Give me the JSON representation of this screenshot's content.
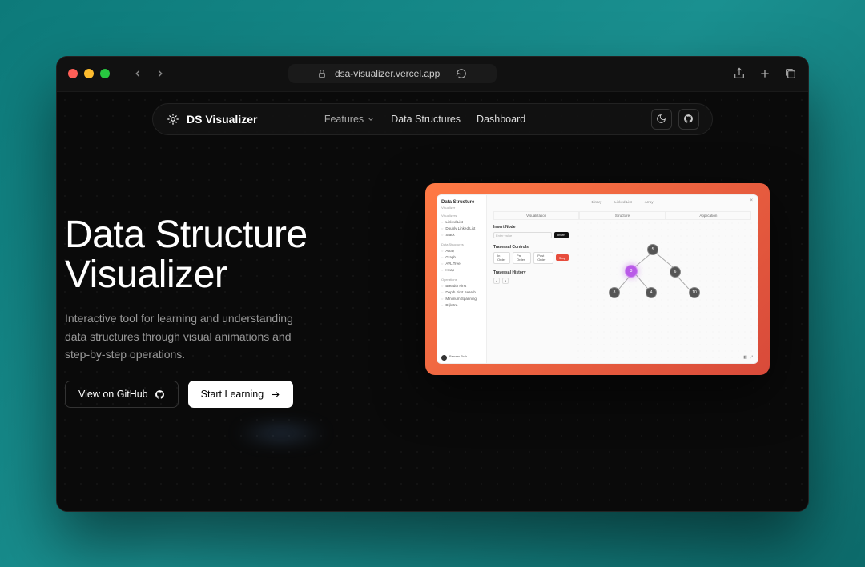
{
  "browser": {
    "url": "dsa-visualizer.vercel.app"
  },
  "navbar": {
    "brand": "DS Visualizer",
    "items": {
      "features": "Features",
      "data_structures": "Data Structures",
      "dashboard": "Dashboard"
    }
  },
  "hero": {
    "title_line1": "Data Structure",
    "title_line2": "Visualizer",
    "subtitle": "Interactive tool for learning and understanding data structures through visual animations and step-by-step operations.",
    "cta_github": "View on GitHub",
    "cta_start": "Start Learning"
  },
  "preview": {
    "app_title": "Data Structure",
    "app_subtitle": "Visualizer",
    "sidebar_groups": [
      {
        "label": "Visualizers",
        "items": [
          "Linked List",
          "Doubly Linked List",
          "Stack"
        ]
      },
      {
        "label": "Data Structures",
        "items": [
          "Array",
          "Graph",
          "AVL Tree",
          "Heap"
        ]
      },
      {
        "label": "Operations",
        "items": [
          "Breadth First",
          "Depth First Search",
          "Minimum Spanning",
          "Dijkstra"
        ]
      }
    ],
    "top_tabs": [
      "Binary",
      "Linked List",
      "Array"
    ],
    "sub_tabs": [
      "Visualization",
      "Structure",
      "Application"
    ],
    "controls": {
      "insert_label": "Insert Node",
      "insert_placeholder": "Enter value",
      "insert_btn": "Insert",
      "traversal_label": "Traversal Controls",
      "traversal_buttons": [
        "In Order",
        "Pre Order",
        "Post Order",
        "Stop"
      ],
      "history_label": "Traversal History",
      "history": [
        "4",
        "5"
      ]
    },
    "tree_nodes": [
      5,
      3,
      6,
      8,
      4,
      10
    ],
    "footer_name": "Ramzan Shah"
  }
}
